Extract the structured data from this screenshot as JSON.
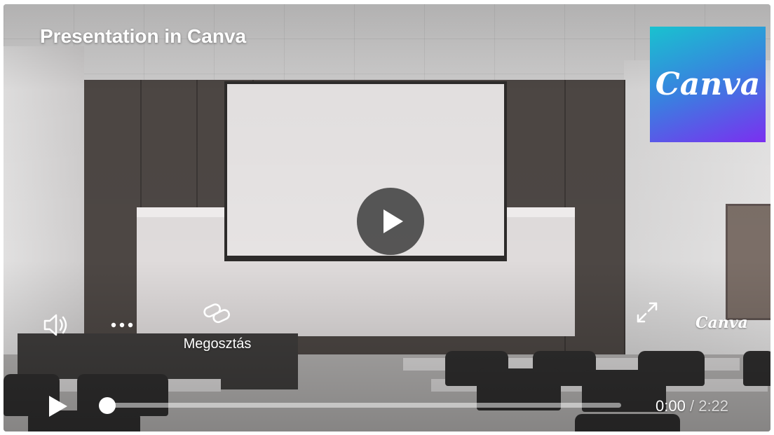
{
  "video": {
    "title": "Presentation in Canva",
    "brand_logo_text": "Canva",
    "watermark_text": "Canva",
    "brand_colors": [
      "#19c2cf",
      "#3a7fe0",
      "#7b2ff0"
    ]
  },
  "controls": {
    "share_label": "Megosztás",
    "current_time": "0:00",
    "separator": "/",
    "duration": "2:22",
    "progress": 0,
    "icons": [
      "play-icon",
      "volume-icon",
      "more-icon",
      "link-icon",
      "fullscreen-icon"
    ]
  }
}
